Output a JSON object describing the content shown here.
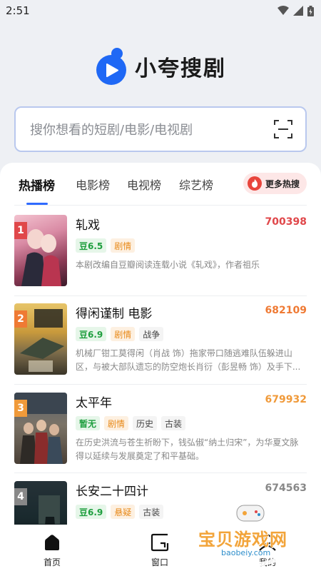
{
  "status_bar": {
    "time": "2:51"
  },
  "app": {
    "name": "小夸搜剧"
  },
  "search": {
    "placeholder": "搜你想看的短剧/电影/电视剧"
  },
  "tabs": [
    "热播榜",
    "电影榜",
    "电视榜",
    "综艺榜"
  ],
  "more_hot_label": "更多热搜",
  "list": [
    {
      "rank": "1",
      "title": "轧戏",
      "heat": "700398",
      "tags": [
        "豆6.5",
        "剧情"
      ],
      "desc": "本剧改编自豆瓣阅读连载小说《轧戏》，作者祖乐"
    },
    {
      "rank": "2",
      "title": "得闲谨制 电影",
      "heat": "682109",
      "tags": [
        "豆6.9",
        "剧情",
        "战争"
      ],
      "desc": "机械厂钳工莫得闲（肖战 饰）拖家带口随逃难队伍躲进山区，与被大部队遗忘的防空炮长肖衍（彭昱畅 饰）及手下..."
    },
    {
      "rank": "3",
      "title": "太平年",
      "heat": "679932",
      "tags": [
        "暂无",
        "剧情",
        "历史",
        "古装"
      ],
      "desc": "在历史洪流与苍生祈盼下，钱弘俶“纳土归宋”，为华夏文脉得以延续与发展奠定了和平基础。"
    },
    {
      "rank": "4",
      "title": "长安二十四计",
      "heat": "674563",
      "tags": [
        "豆6.9",
        "悬疑",
        "古装"
      ],
      "desc": ""
    }
  ],
  "bottom_nav": [
    {
      "label": "首页",
      "icon": "home-icon"
    },
    {
      "label": "窗口",
      "icon": "window-icon"
    },
    {
      "label": "我的",
      "icon": "profile-icon"
    }
  ],
  "watermark": {
    "text": "宝贝游戏网",
    "url": "baobeiy.com"
  },
  "colors": {
    "accent": "#2f6bff",
    "rank1": "#e0474a",
    "rank2": "#ef7a34",
    "rank3": "#f09a3a",
    "rank4": "#888888"
  }
}
